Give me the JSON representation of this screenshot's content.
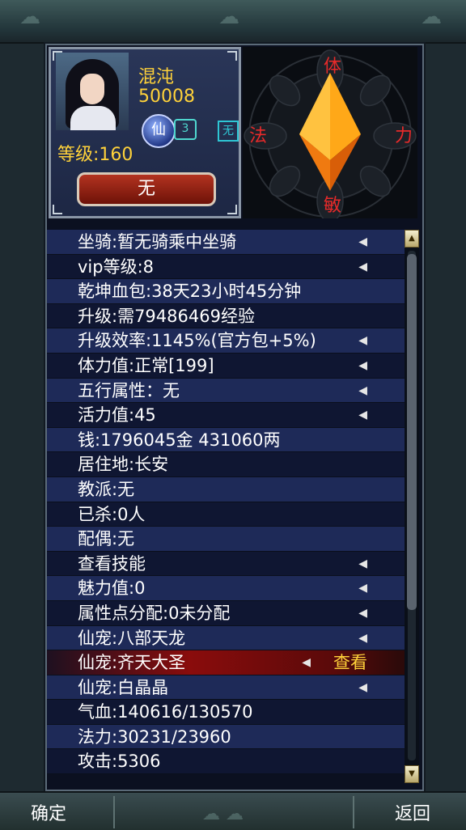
{
  "character": {
    "name": "混沌",
    "id": "50008",
    "level": "等级:160",
    "xian_icon": "仙",
    "rank_icon": "3",
    "element_icon": "无",
    "title_button": "无"
  },
  "compass": {
    "top": "体",
    "left": "法",
    "right": "力",
    "bottom": "敏"
  },
  "rows": [
    {
      "text": "坐骑:暂无骑乘中坐骑",
      "arrow": true
    },
    {
      "text": "vip等级:8",
      "arrow": true
    },
    {
      "text": "乾坤血包:38天23小时45分钟",
      "arrow": false
    },
    {
      "text": "升级:需79486469经验",
      "arrow": false
    },
    {
      "text": "升级效率:1145%(官方包+5%)",
      "arrow": true
    },
    {
      "text": "体力值:正常[199]",
      "arrow": true
    },
    {
      "text": "五行属性：无",
      "arrow": true
    },
    {
      "text": "活力值:45",
      "arrow": true
    },
    {
      "text": "钱:1796045金 431060两",
      "arrow": false
    },
    {
      "text": "居住地:长安",
      "arrow": false
    },
    {
      "text": "教派:无",
      "arrow": false
    },
    {
      "text": "已杀:0人",
      "arrow": false
    },
    {
      "text": "配偶:无",
      "arrow": false
    },
    {
      "text": "查看技能",
      "arrow": true
    },
    {
      "text": "魅力值:0",
      "arrow": true
    },
    {
      "text": "属性点分配:0未分配",
      "arrow": true
    },
    {
      "text": "仙宠:八部天龙",
      "arrow": true
    },
    {
      "text": "仙宠:齐天大圣",
      "arrow": false,
      "selected": true,
      "action": "查看"
    },
    {
      "text": "仙宠:白晶晶",
      "arrow": true
    },
    {
      "text": "气血:140616/130570",
      "arrow": false
    },
    {
      "text": "法力:30231/23960",
      "arrow": false
    },
    {
      "text": "攻击:5306",
      "arrow": false
    }
  ],
  "bottom": {
    "confirm": "确定",
    "back": "返回"
  },
  "icons": {
    "arrow": "left-arrow-icon",
    "scroll_up": "scroll-up-icon",
    "scroll_down": "scroll-down-icon"
  },
  "colors": {
    "gold_text": "#ffd23a",
    "compass_red": "#e82a2a",
    "row_odd": "#1e2a58",
    "row_even": "#0f1632",
    "selected_row": "#8a0c0c"
  }
}
